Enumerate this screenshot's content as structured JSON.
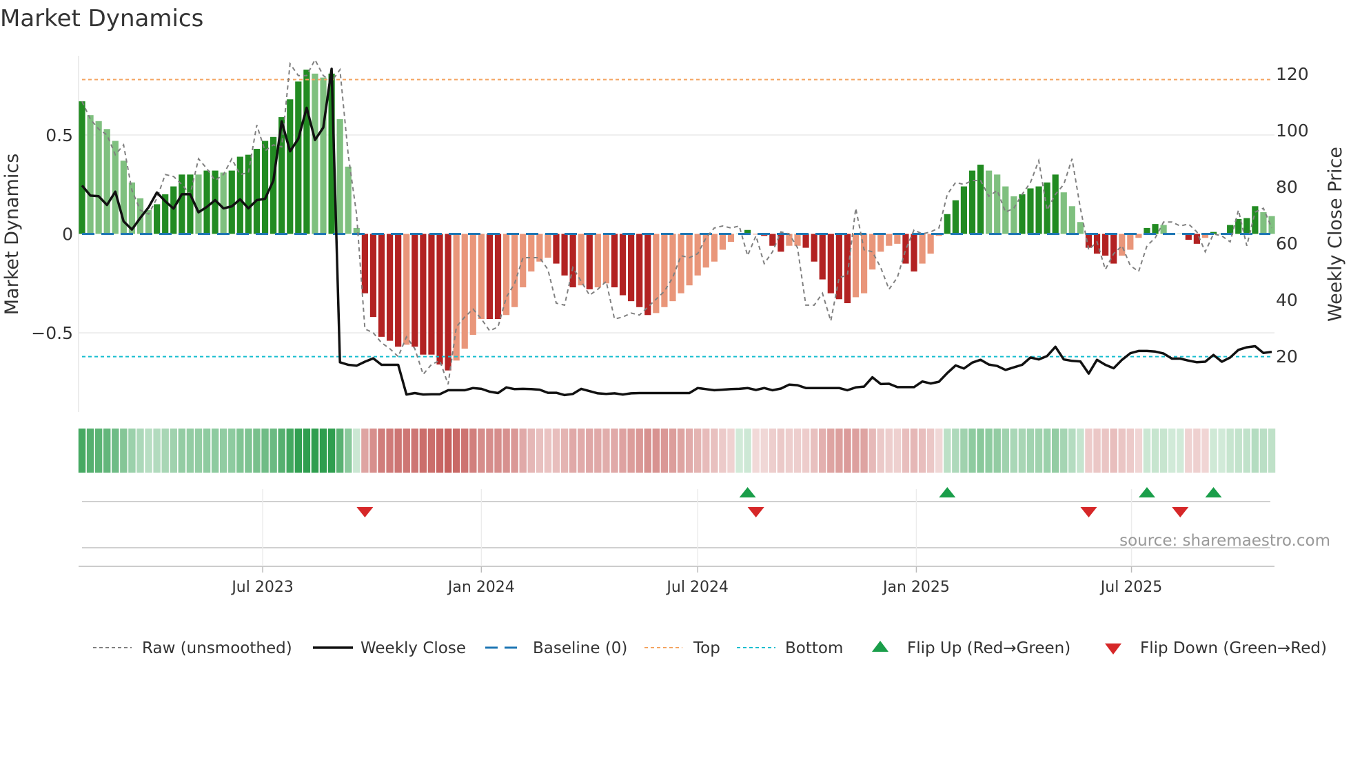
{
  "title": "Market Dynamics",
  "source": "source: sharemaestro.com",
  "colors": {
    "strong_up": "#228b22",
    "weak_up": "#7fc07f",
    "strong_down": "#b22222",
    "weak_down": "#e9967a",
    "heat_up": "#2f9e4f",
    "heat_down": "#c0504d",
    "top": "#f4a460",
    "bottom": "#17becf",
    "baseline": "#1f77b4",
    "flip_up": "#1a9e4a",
    "flip_down": "#d62728",
    "close": "#111111",
    "raw": "#808080"
  },
  "legend": {
    "raw": "Raw (unsmoothed)",
    "close": "Weekly Close",
    "baseline": "Baseline (0)",
    "top": "Top",
    "bottom": "Bottom",
    "flip_up": "Flip Up (Red→Green)",
    "flip_down": "Flip Down (Green→Red)"
  },
  "chart_data": {
    "type": "bar",
    "title": "Market Dynamics",
    "ylabel": "Market Dynamics",
    "y2label": "Weekly Close Price",
    "frequency": "weekly",
    "start_date": "2023-01-30",
    "ylim": [
      -0.9,
      0.9
    ],
    "y2lim": [
      0.3,
      126.4
    ],
    "yticks": [
      {
        "v": 0.5,
        "label": "0.5"
      },
      {
        "v": 0,
        "label": "0"
      },
      {
        "v": -0.5,
        "label": "−0.5"
      }
    ],
    "y2ticks": [
      {
        "v": 120,
        "label": "120"
      },
      {
        "v": 100,
        "label": "100"
      },
      {
        "v": 80,
        "label": "80"
      },
      {
        "v": 60,
        "label": "60"
      },
      {
        "v": 40,
        "label": "40"
      },
      {
        "v": 20,
        "label": "20"
      }
    ],
    "xticks": [
      {
        "date": "2023-07-01",
        "label": "Jul 2023"
      },
      {
        "date": "2024-01-01",
        "label": "Jan 2024"
      },
      {
        "date": "2024-07-01",
        "label": "Jul 2024"
      },
      {
        "date": "2025-01-01",
        "label": "Jan 2025"
      },
      {
        "date": "2025-07-01",
        "label": "Jul 2025"
      }
    ],
    "top_level": 0.78,
    "bottom_level": -0.62,
    "baseline": 0,
    "dynamics": [
      0.67,
      0.6,
      0.57,
      0.53,
      0.47,
      0.37,
      0.26,
      0.18,
      0.12,
      0.15,
      0.2,
      0.24,
      0.3,
      0.3,
      0.3,
      0.32,
      0.32,
      0.31,
      0.32,
      0.39,
      0.4,
      0.43,
      0.47,
      0.49,
      0.59,
      0.68,
      0.77,
      0.83,
      0.81,
      0.79,
      0.81,
      0.58,
      0.34,
      0.03,
      -0.3,
      -0.42,
      -0.52,
      -0.54,
      -0.57,
      -0.56,
      -0.57,
      -0.61,
      -0.61,
      -0.66,
      -0.69,
      -0.64,
      -0.58,
      -0.51,
      -0.43,
      -0.43,
      -0.43,
      -0.41,
      -0.37,
      -0.27,
      -0.19,
      -0.14,
      -0.12,
      -0.15,
      -0.21,
      -0.27,
      -0.26,
      -0.28,
      -0.27,
      -0.25,
      -0.27,
      -0.31,
      -0.34,
      -0.37,
      -0.41,
      -0.4,
      -0.37,
      -0.34,
      -0.3,
      -0.26,
      -0.21,
      -0.17,
      -0.14,
      -0.08,
      -0.04,
      0.0,
      0.02,
      -0.003,
      -0.01,
      -0.06,
      -0.09,
      -0.06,
      -0.06,
      -0.07,
      -0.14,
      -0.23,
      -0.3,
      -0.33,
      -0.35,
      -0.32,
      -0.3,
      -0.18,
      -0.09,
      -0.06,
      -0.05,
      -0.15,
      -0.19,
      -0.15,
      -0.1,
      -0.01,
      0.1,
      0.17,
      0.24,
      0.32,
      0.35,
      0.32,
      0.3,
      0.24,
      0.19,
      0.2,
      0.23,
      0.24,
      0.26,
      0.3,
      0.21,
      0.14,
      0.06,
      -0.07,
      -0.1,
      -0.11,
      -0.15,
      -0.11,
      -0.08,
      -0.02,
      0.03,
      0.05,
      0.045,
      0.004,
      0.0,
      -0.03,
      -0.05,
      -0.02,
      0.01,
      0.0,
      0.045,
      0.075,
      0.08,
      0.14,
      0.11,
      0.09
    ],
    "strong": [
      1,
      0,
      0,
      0,
      0,
      0,
      0,
      0,
      0,
      1,
      1,
      1,
      1,
      1,
      0,
      1,
      1,
      0,
      1,
      1,
      1,
      1,
      1,
      1,
      1,
      1,
      1,
      1,
      0,
      0,
      1,
      0,
      0,
      0,
      1,
      1,
      1,
      1,
      1,
      0,
      1,
      1,
      1,
      1,
      1,
      0,
      0,
      0,
      0,
      1,
      1,
      0,
      0,
      0,
      0,
      0,
      0,
      1,
      1,
      1,
      0,
      1,
      0,
      0,
      1,
      1,
      1,
      1,
      1,
      0,
      0,
      0,
      0,
      0,
      0,
      0,
      0,
      0,
      0,
      0,
      1,
      0,
      1,
      1,
      1,
      0,
      0,
      1,
      1,
      1,
      1,
      1,
      1,
      0,
      0,
      0,
      0,
      0,
      0,
      1,
      1,
      0,
      0,
      0,
      1,
      1,
      1,
      1,
      1,
      0,
      0,
      0,
      0,
      1,
      1,
      1,
      1,
      1,
      0,
      0,
      0,
      1,
      1,
      1,
      1,
      0,
      0,
      0,
      1,
      1,
      0,
      0,
      0,
      1,
      1,
      0,
      1,
      0,
      1,
      1,
      1,
      1,
      0,
      0
    ],
    "raw": [
      0.67,
      0.58,
      0.53,
      0.5,
      0.4,
      0.45,
      0.22,
      0.12,
      0.1,
      0.18,
      0.3,
      0.29,
      0.25,
      0.2,
      0.38,
      0.33,
      0.27,
      0.3,
      0.38,
      0.3,
      0.31,
      0.55,
      0.42,
      0.45,
      0.44,
      0.86,
      0.8,
      0.8,
      0.88,
      0.8,
      0.77,
      0.83,
      0.4,
      0.1,
      -0.48,
      -0.5,
      -0.55,
      -0.58,
      -0.62,
      -0.52,
      -0.58,
      -0.71,
      -0.66,
      -0.64,
      -0.76,
      -0.47,
      -0.42,
      -0.38,
      -0.43,
      -0.49,
      -0.47,
      -0.32,
      -0.25,
      -0.12,
      -0.12,
      -0.12,
      -0.18,
      -0.35,
      -0.36,
      -0.17,
      -0.24,
      -0.31,
      -0.28,
      -0.24,
      -0.43,
      -0.42,
      -0.4,
      -0.41,
      -0.37,
      -0.33,
      -0.29,
      -0.22,
      -0.11,
      -0.12,
      -0.1,
      -0.02,
      0.03,
      0.04,
      0.03,
      0.04,
      -0.11,
      -0.01,
      -0.15,
      -0.09,
      0.01,
      0.0,
      -0.07,
      -0.36,
      -0.36,
      -0.3,
      -0.44,
      -0.22,
      -0.21,
      0.13,
      -0.08,
      -0.09,
      -0.17,
      -0.28,
      -0.22,
      -0.08,
      0.02,
      0.0,
      0.01,
      0.03,
      0.2,
      0.26,
      0.25,
      0.27,
      0.27,
      0.19,
      0.22,
      0.11,
      0.13,
      0.2,
      0.26,
      0.37,
      0.12,
      0.2,
      0.25,
      0.38,
      0.13,
      -0.08,
      -0.04,
      -0.18,
      -0.1,
      -0.06,
      -0.16,
      -0.19,
      -0.06,
      -0.02,
      0.06,
      0.06,
      0.04,
      0.05,
      0.01,
      -0.09,
      0.0,
      -0.01,
      -0.04,
      0.12,
      -0.06,
      0.11,
      0.13,
      0.03
    ],
    "weekly_close": [
      80.5,
      76.9,
      76.7,
      73.6,
      78.3,
      67.8,
      64.9,
      69,
      72.8,
      78,
      74.9,
      72.3,
      77.4,
      77.4,
      71,
      72.9,
      75.3,
      72.4,
      73.1,
      75.6,
      72.4,
      75.3,
      75.8,
      82.2,
      103.2,
      92.6,
      97,
      108,
      96.6,
      101,
      121.8,
      17.9,
      17,
      16.7,
      18.1,
      19.3,
      17,
      17,
      17,
      6.5,
      7,
      6.5,
      6.6,
      6.6,
      8,
      8,
      8,
      8.8,
      8.5,
      7.5,
      7,
      9,
      8.4,
      8.5,
      8.4,
      8.2,
      7.1,
      7.1,
      6.3,
      6.7,
      8.5,
      7.7,
      6.9,
      6.7,
      6.9,
      6.5,
      6.9,
      7,
      7,
      7,
      7,
      7,
      7,
      7,
      8.8,
      8.4,
      8,
      8.2,
      8.4,
      8.5,
      8.8,
      8.1,
      8.8,
      8,
      8.6,
      10,
      9.8,
      8.8,
      8.8,
      8.8,
      8.8,
      8.8,
      8,
      9,
      9.3,
      12.6,
      10.2,
      10.3,
      9.1,
      9.1,
      9.1,
      11.1,
      10.4,
      11,
      14.1,
      16.8,
      15.7,
      17.8,
      18.8,
      17.1,
      16.6,
      15.2,
      16.1,
      17,
      19.6,
      18.9,
      20.1,
      23.4,
      18.9,
      18.4,
      18.2,
      13.9,
      18.8,
      17,
      15.8,
      18.8,
      21.1,
      21.9,
      21.9,
      21.7,
      21,
      19.2,
      19.2,
      18.5,
      17.9,
      18.1,
      20.5,
      18.1,
      19.6,
      22.3,
      23.2,
      23.6,
      21.2,
      21.6
    ],
    "flip_up_weeks": [
      81,
      105,
      129,
      137
    ],
    "flip_down_weeks": [
      35,
      82,
      122,
      133
    ],
    "legend_position": "bottom"
  }
}
